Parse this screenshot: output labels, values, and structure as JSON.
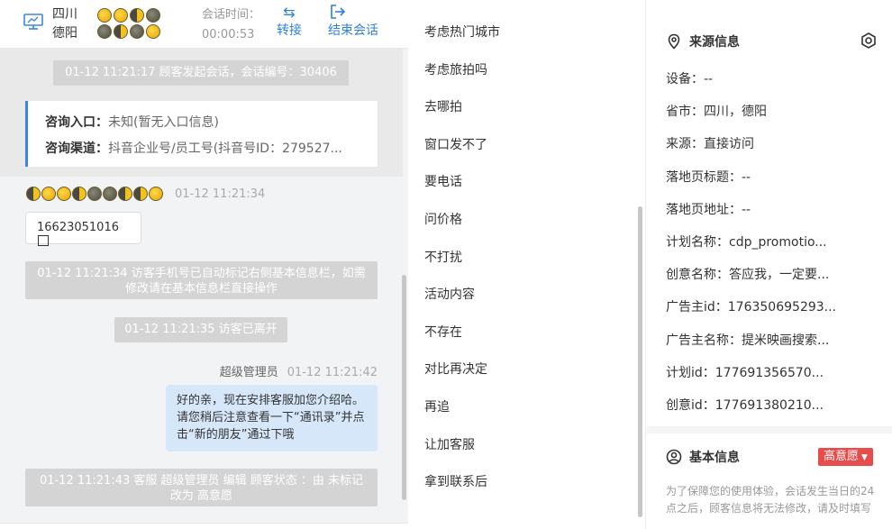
{
  "header": {
    "province": "四川",
    "city": "德阳",
    "emoji_row1": [
      "y",
      "y",
      "h",
      "d"
    ],
    "emoji_row2": [
      "d",
      "h",
      "d",
      "y"
    ],
    "session_label": "会话时间：",
    "session_time": "00:00:53",
    "transfer_label": "转接",
    "end_label": "结束会话"
  },
  "chat": {
    "system_start": "01-12 11:21:17 顾客发起会话，会话编号：30406",
    "entry_label": "咨询入口：",
    "entry_value": "未知(暂无入口信息)",
    "channel_label": "咨询渠道：",
    "channel_value": "抖音企业号/员工号(抖音号ID：279527...",
    "visitor_emojis": [
      "h",
      "y",
      "y",
      "h",
      "d",
      "d",
      "h",
      "h",
      "y"
    ],
    "visitor_time": "01-12 11:21:34",
    "visitor_phone": "16623051016",
    "system_marked": "01-12 11:21:34 访客手机号已自动标记右侧基本信息栏，如需修改请在基本信息栏直接操作",
    "system_left": "01-12 11:21:35 访客已离开",
    "agent_name": "超级管理员",
    "agent_time": "01-12 11:21:42",
    "agent_message": "好的亲，现在安排客服加您介绍哈。请您稍后注意查看一下“通讯录”并点击“新的朋友”通过下哦",
    "system_status": "01-12 11:21:43 客服 超级管理员 编辑 顾客状态 ：由 未标记 改为 高意愿"
  },
  "quick_replies": [
    "考虑热门城市",
    "考虑旅拍吗",
    "去哪拍",
    "窗口发不了",
    "要电话",
    "问价格",
    "不打扰",
    "活动内容",
    "不存在",
    "对比再决定",
    "再追",
    "让加客服",
    "拿到联系后"
  ],
  "source_info": {
    "title": "来源信息",
    "fields": [
      "设备：--",
      "省市：四川，德阳",
      "来源：直接访问",
      "落地页标题：--",
      "落地页地址：--",
      "计划名称：cdp_promotio...",
      "创意名称：答应我，一定要...",
      "广告主id：176350695293...",
      "广告主名称：提米映画搜索...",
      "计划id：177691356570...",
      "创意id：177691380210..."
    ]
  },
  "basic_info": {
    "title": "基本信息",
    "intent": "高意愿",
    "notice": "为了保障您的使用体验，会话发生当日的24点之后，顾客信息将无法修改，请及时填写"
  },
  "colors": {
    "accent": "#2f7fd8",
    "agent_bubble": "#d6e7fa",
    "system_msg": "#d4d4d4",
    "intent_badge": "#e74c4c"
  }
}
